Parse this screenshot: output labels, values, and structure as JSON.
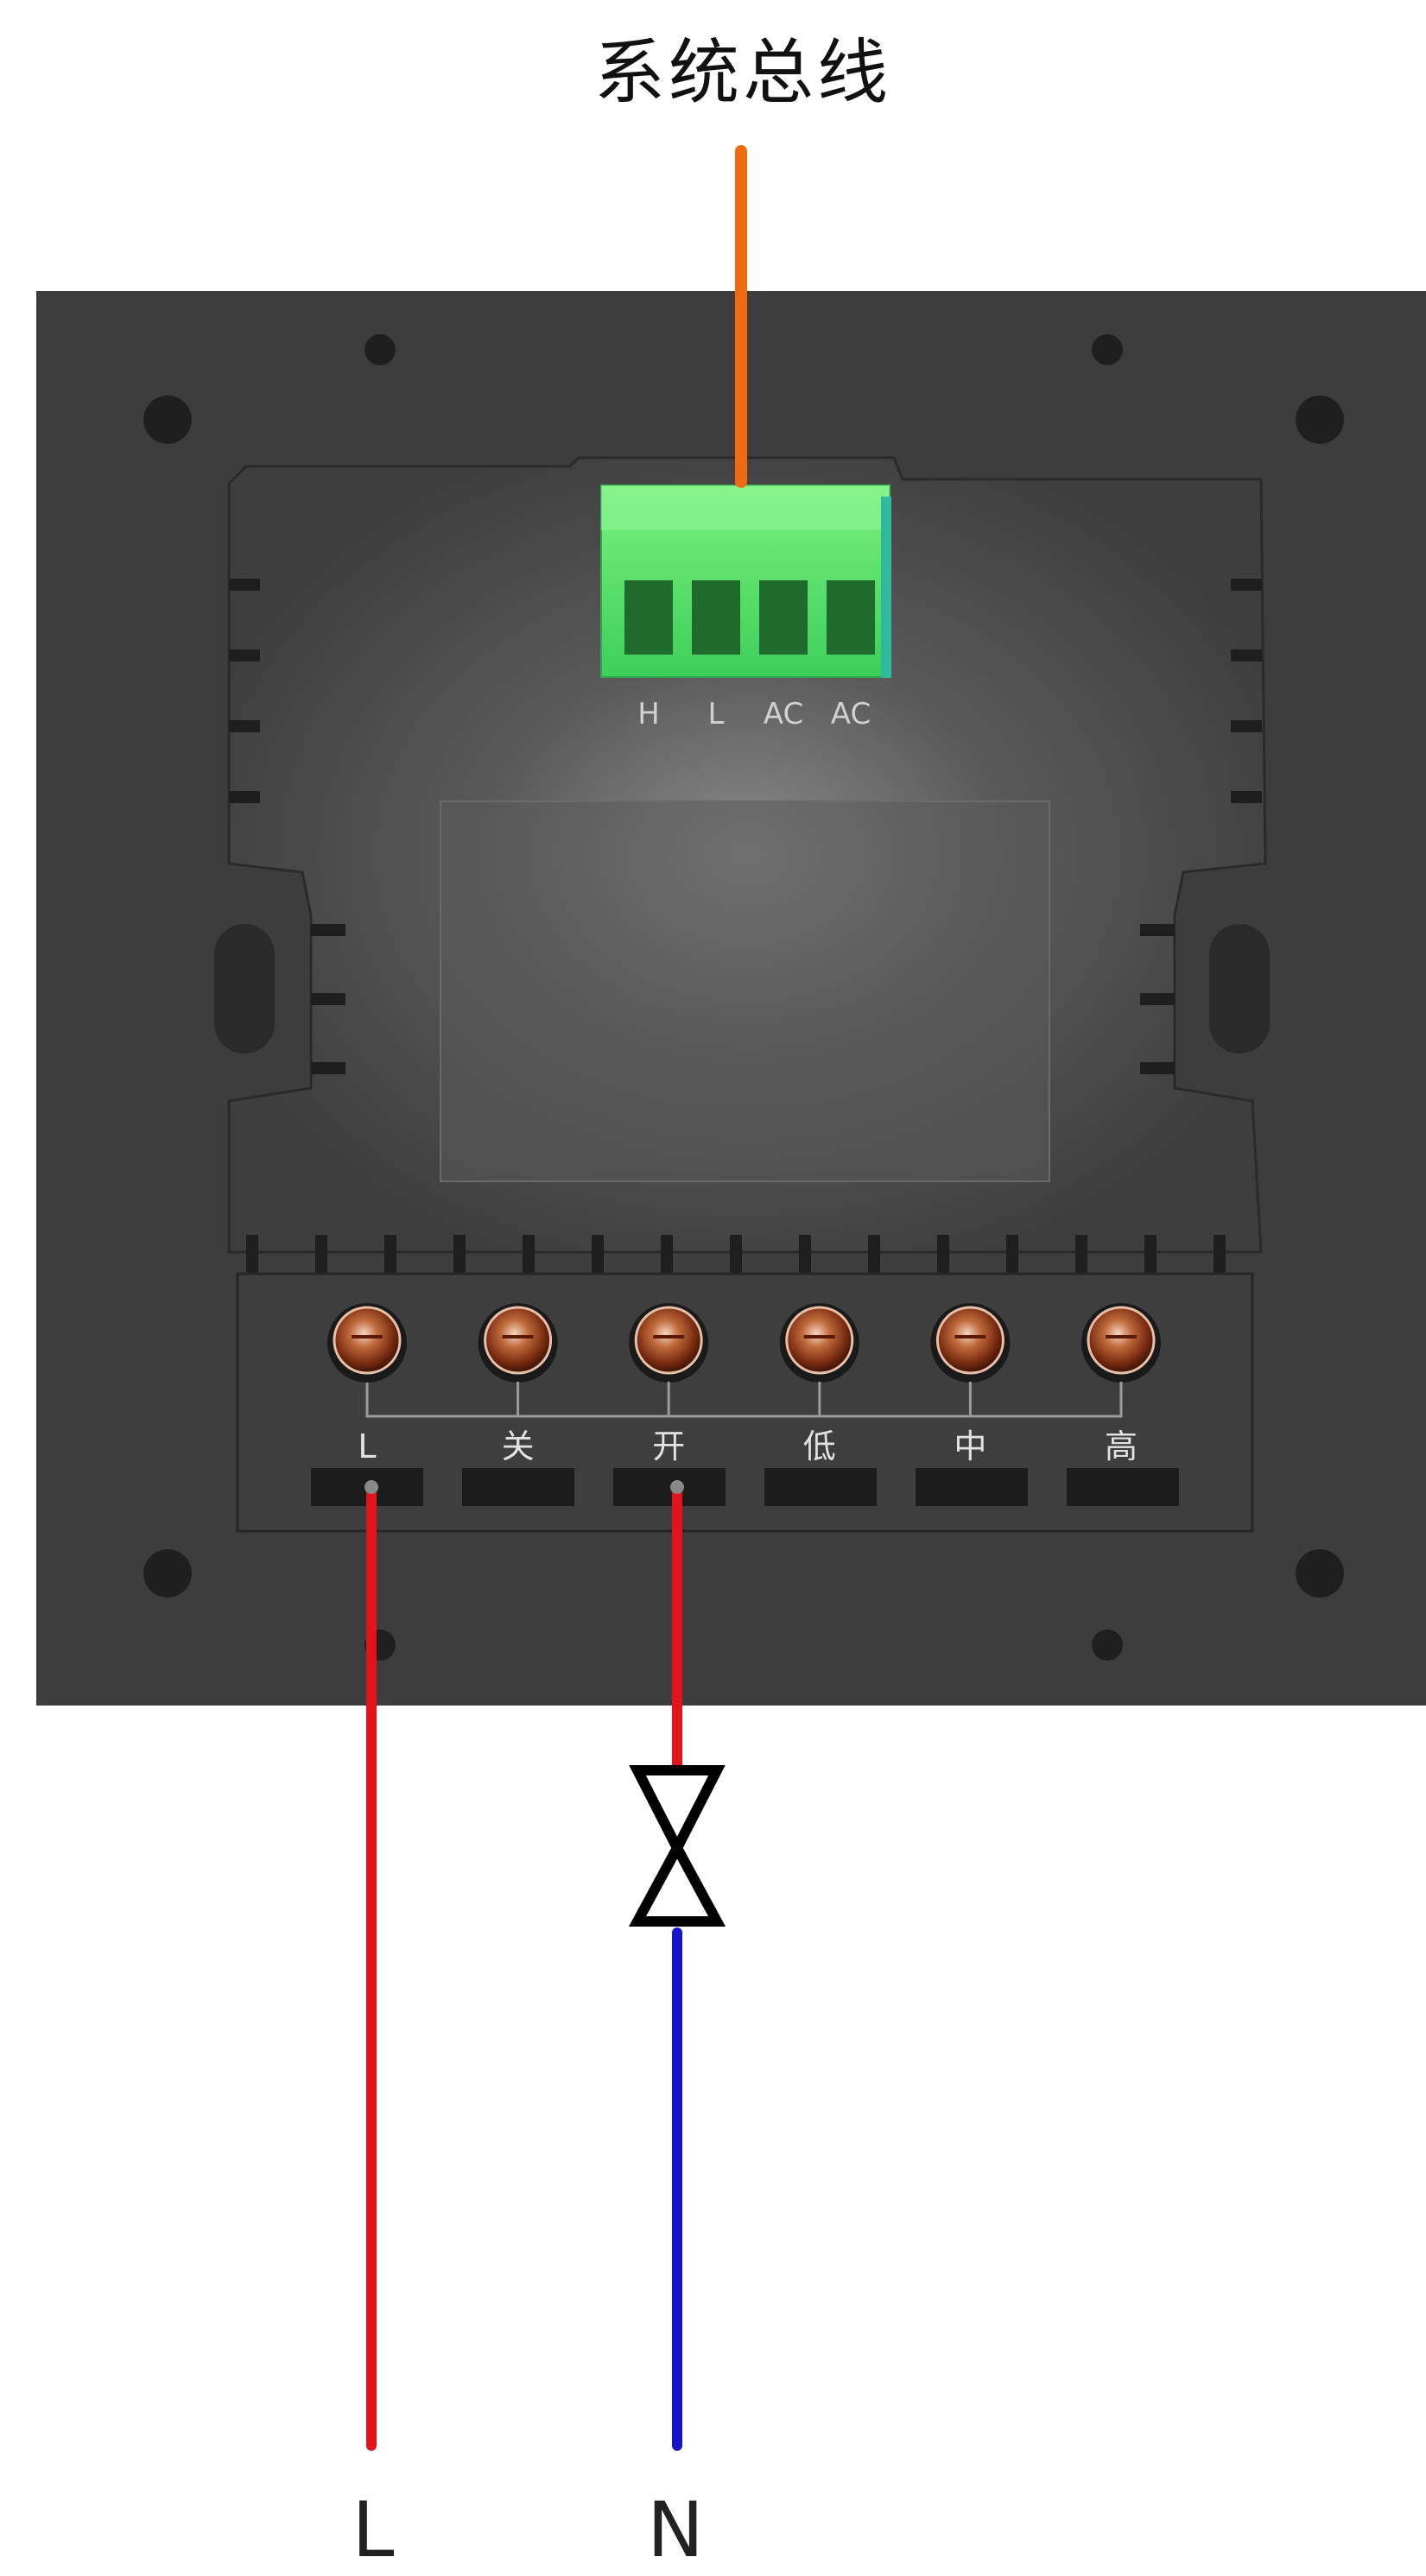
{
  "title": "系统总线",
  "bus_connector": {
    "pins": [
      "H",
      "L",
      "AC",
      "AC"
    ],
    "color": "#5fe870"
  },
  "terminals": [
    "L",
    "关",
    "开",
    "低",
    "中",
    "高"
  ],
  "wires": {
    "bus": {
      "color": "#f06a10"
    },
    "live": {
      "label": "L",
      "color": "#e0141a"
    },
    "neutral": {
      "label": "N",
      "color": "#1414c8"
    }
  },
  "panel_color": "#3c3c3c"
}
